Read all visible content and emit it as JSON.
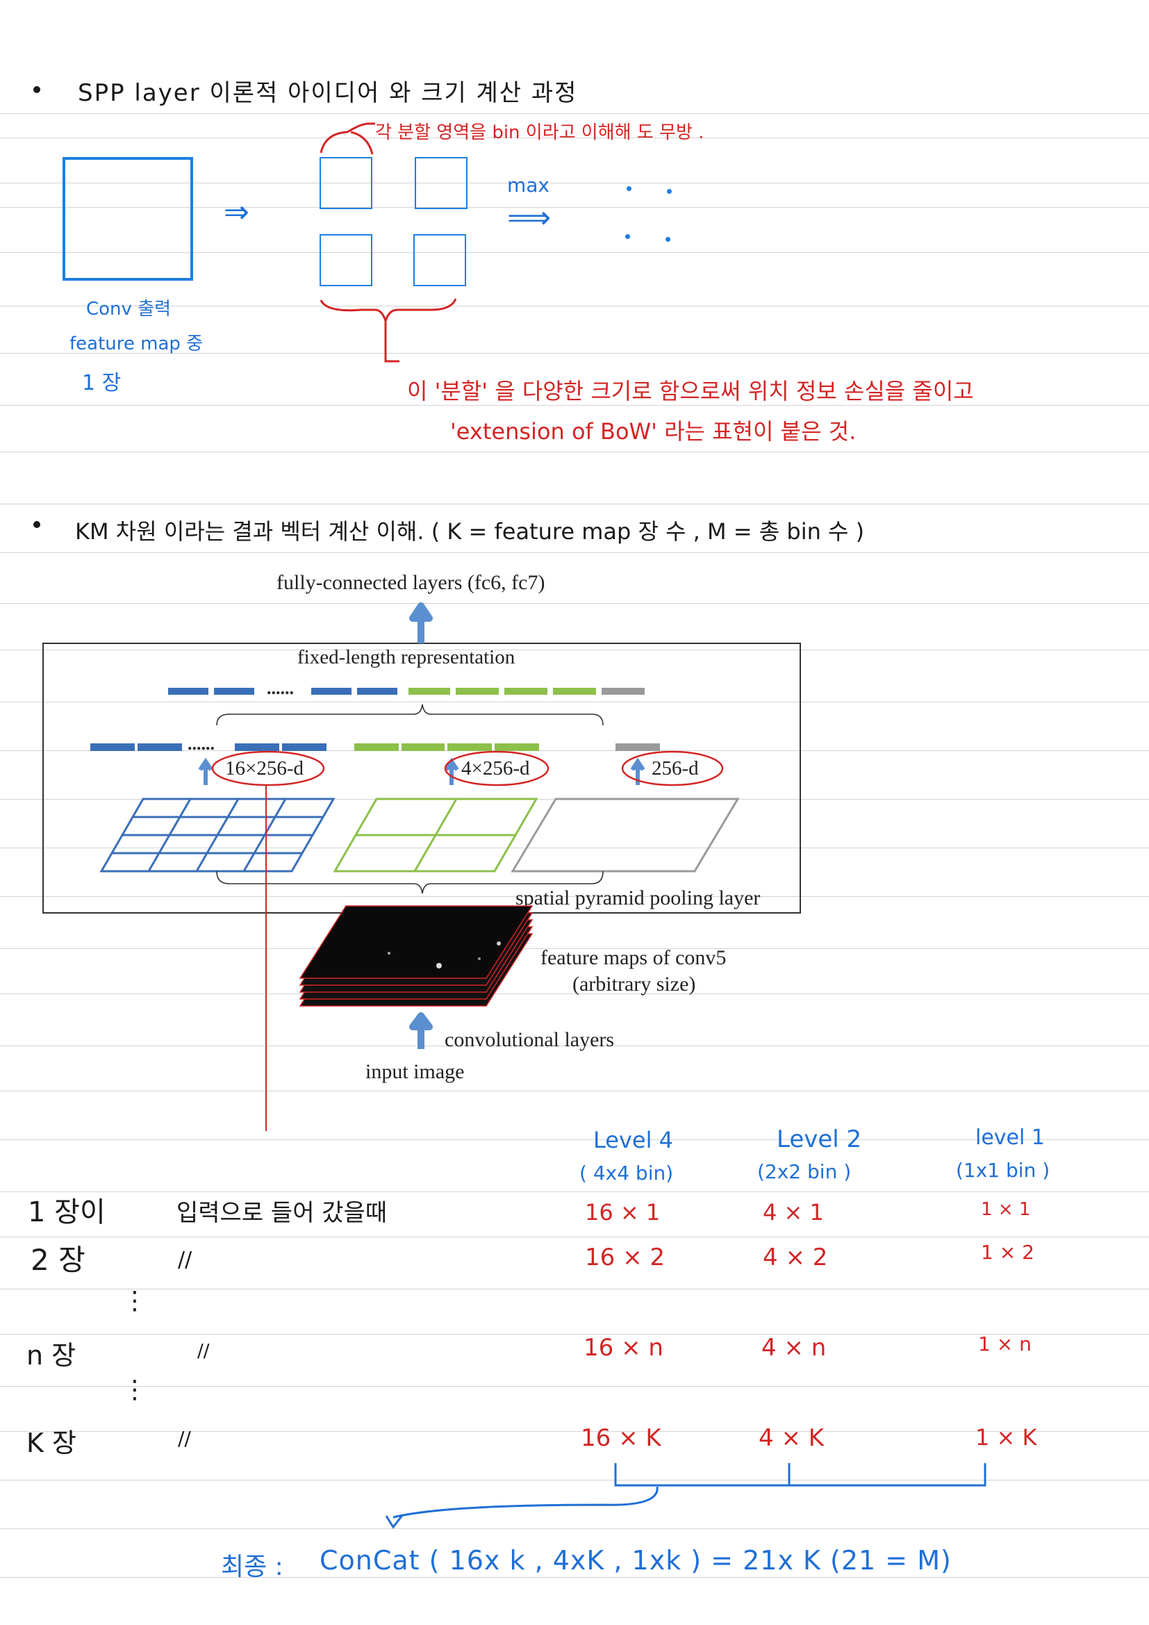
{
  "section1": {
    "title": "SPP layer  이론적 아이디어 와 크기 계산 과정",
    "bin_note": "각 분할 영역을 bin 이라고 이해해 도 무방 .",
    "max_label": "max",
    "conv_caption": [
      "Conv 출력",
      "feature map 중",
      "1 장"
    ],
    "bracket_note_1": "이 '분할' 을 다양한 크기로 함으로써 위치 정보 손실을 줄이고",
    "bracket_note_2": "'extension of BoW' 라는 표현이 붙은 것."
  },
  "section2": {
    "title": "KM 차원 이라는 결과 벡터 계산 이해. ( K = feature map 장 수 , M = 총 bin 수 )"
  },
  "figure": {
    "top_label": "fully-connected layers (fc6, fc7)",
    "fixed_label": "fixed-length representation",
    "dim_16": "16×256-d",
    "dim_4": "4×256-d",
    "dim_1": "256-d",
    "dots": "......",
    "spp_label": "spatial pyramid pooling layer",
    "feature_label_1": "feature maps of conv5",
    "feature_label_2": "(arbitrary size)",
    "conv_label": "convolutional layers",
    "input_label": "input image"
  },
  "table": {
    "headers": [
      {
        "level": "Level 4",
        "bins": "( 4x4 bin)"
      },
      {
        "level": "Level 2",
        "bins": "(2x2 bin )"
      },
      {
        "level": "level 1",
        "bins": "(1x1 bin )"
      }
    ],
    "rows": [
      {
        "label": "1 장이",
        "desc": "입력으로 들어 갔을때",
        "cells": [
          "16 × 1",
          "4 × 1",
          "1 × 1"
        ]
      },
      {
        "label": "2 장",
        "desc": "//",
        "cells": [
          "16 × 2",
          "4 × 2",
          "1 × 2"
        ]
      },
      {
        "label": "n 장",
        "desc": "//",
        "cells": [
          "16 × n",
          "4 × n",
          "1 × n"
        ]
      },
      {
        "label": "K 장",
        "desc": "//",
        "cells": [
          "16 × K",
          "4 × K",
          "1 × K"
        ]
      }
    ],
    "vdots": "⋮"
  },
  "final": {
    "label": "최종 :",
    "formula": "ConCat ( 16x k , 4xK , 1xk ) = 21x K (21 = M)"
  },
  "colors": {
    "ink_black": "#1a1a1a",
    "ink_blue": "#1f6fd6",
    "ink_red": "#d42424",
    "fig_blue": "#3a6fb8",
    "fig_green": "#8cc04a",
    "fig_gray": "#9a9a9a"
  }
}
